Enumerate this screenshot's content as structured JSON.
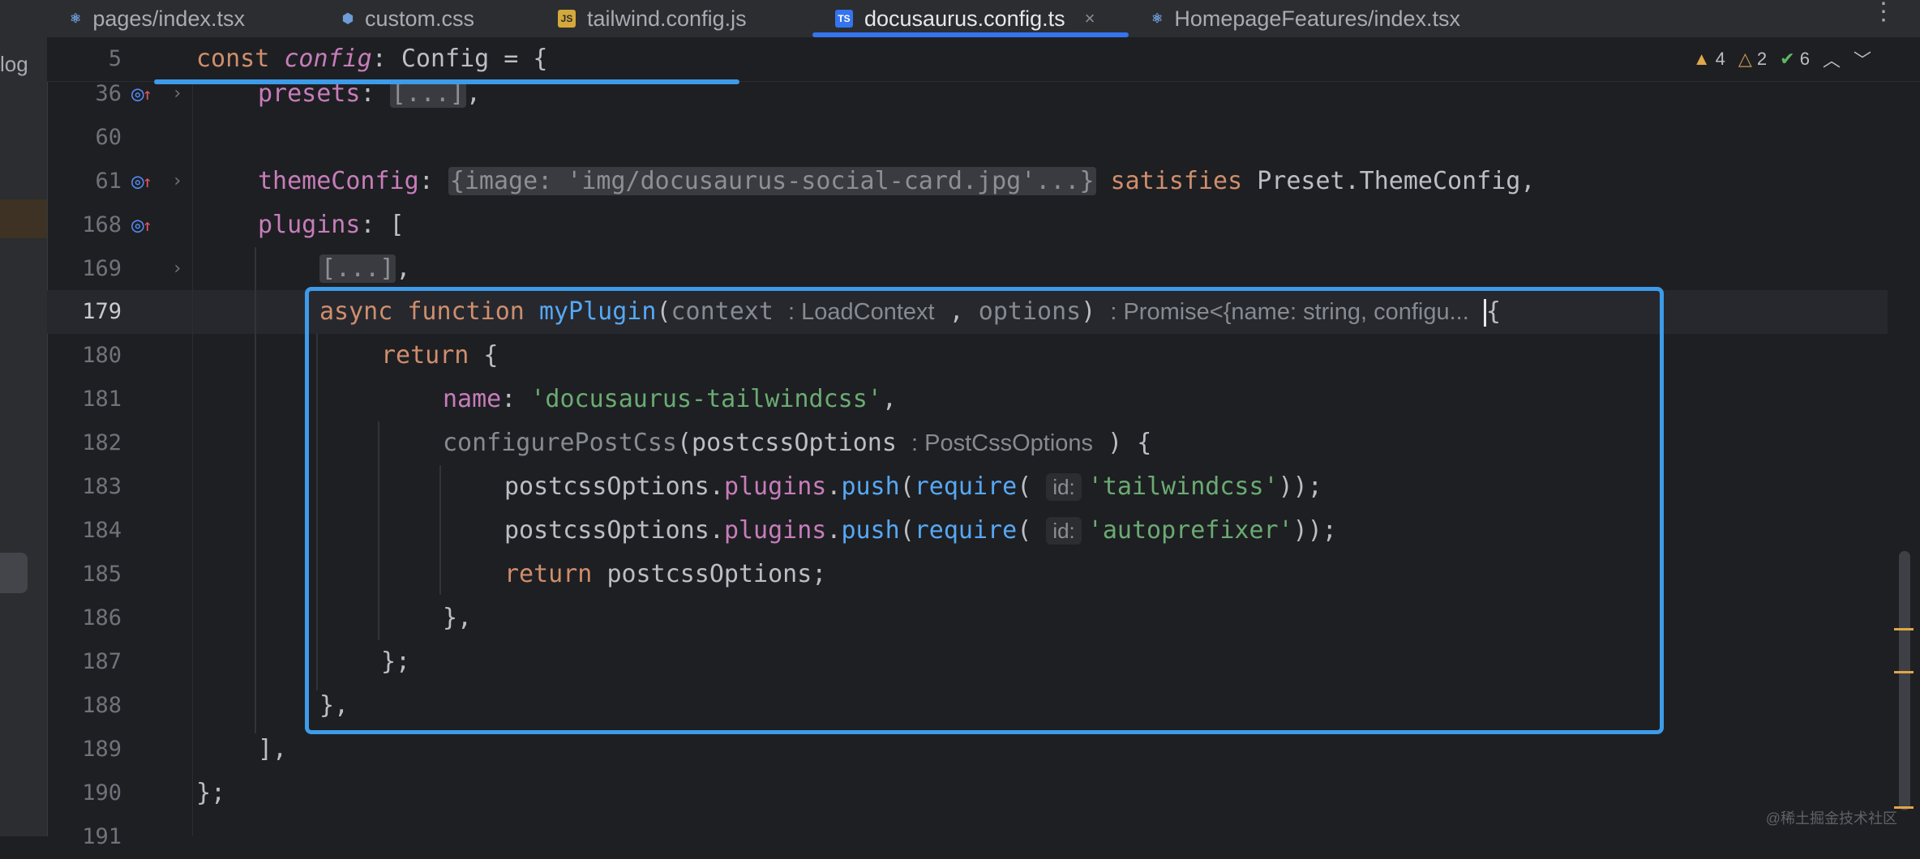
{
  "tabs": [
    {
      "label": "pages/index.tsx",
      "icon": "react-icon",
      "active": false
    },
    {
      "label": "custom.css",
      "icon": "css-icon",
      "active": false
    },
    {
      "label": "tailwind.config.js",
      "icon": "js-icon",
      "active": false
    },
    {
      "label": "docusaurus.config.ts",
      "icon": "ts-icon",
      "active": true
    },
    {
      "label": "HomepageFeatures/index.tsx",
      "icon": "react-icon",
      "active": false
    }
  ],
  "tab_close_glyph": "×",
  "tab_more_glyph": "⋮",
  "tool_window_label": "log",
  "sticky": {
    "line_number": "5",
    "keyword": "const",
    "name": "config",
    "rest": ": Config = {"
  },
  "inspections": {
    "errors": "4",
    "warnings": "2",
    "ok": "6"
  },
  "line_numbers": [
    "36",
    "60",
    "61",
    "168",
    "169",
    "179",
    "180",
    "181",
    "182",
    "183",
    "184",
    "185",
    "186",
    "187",
    "188",
    "189",
    "190",
    "191"
  ],
  "code": {
    "presets_key": "presets",
    "presets_folded": "[...]",
    "themeconfig_key": "themeConfig",
    "themeconfig_folded": "{image: 'img/docusaurus-social-card.jpg'...}",
    "satisfies_kw": "satisfies",
    "themeconfig_type": "Preset.ThemeConfig,",
    "plugins_key": "plugins",
    "plugins_open": ": [",
    "plugins_folded": "[...]",
    "async_kw": "async",
    "function_kw": "function",
    "fn_name": "myPlugin",
    "param1": "context",
    "param1_type_hint": ": LoadContext",
    "param2": "options",
    "return_type_hint": ": Promise<{name: string, configu...",
    "open_brace": "{",
    "return_kw": "return",
    "name_key": "name",
    "name_value": "'docusaurus-tailwindcss'",
    "configure_fn": "configurePostCss",
    "postcss_param": "postcssOptions",
    "postcss_type_hint": ": PostCssOptions",
    "obj": "postcssOptions",
    "plugins_prop": "plugins",
    "push_fn": "push",
    "require_fn": "require",
    "id_hint": "id:",
    "tailwind_str": "'tailwindcss'",
    "autoprefixer_str": "'autoprefixer'",
    "return_value": "postcssOptions;",
    "close_fn": "},",
    "close_obj": "};",
    "close_plugin": "},",
    "close_array": "],",
    "close_config": "};"
  },
  "watermark": "@稀土掘金技术社区"
}
